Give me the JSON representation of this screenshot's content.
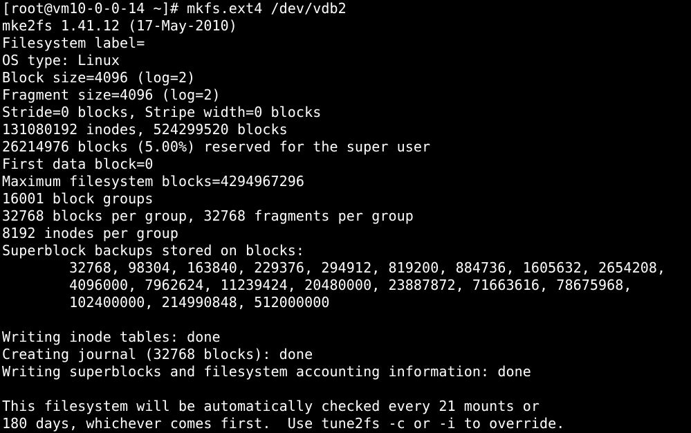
{
  "terminal": {
    "lines": [
      "[root@vm10-0-0-14 ~]# mkfs.ext4 /dev/vdb2",
      "mke2fs 1.41.12 (17-May-2010)",
      "Filesystem label=",
      "OS type: Linux",
      "Block size=4096 (log=2)",
      "Fragment size=4096 (log=2)",
      "Stride=0 blocks, Stripe width=0 blocks",
      "131080192 inodes, 524299520 blocks",
      "26214976 blocks (5.00%) reserved for the super user",
      "First data block=0",
      "Maximum filesystem blocks=4294967296",
      "16001 block groups",
      "32768 blocks per group, 32768 fragments per group",
      "8192 inodes per group",
      "Superblock backups stored on blocks:",
      "        32768, 98304, 163840, 229376, 294912, 819200, 884736, 1605632, 2654208,",
      "        4096000, 7962624, 11239424, 20480000, 23887872, 71663616, 78675968,",
      "        102400000, 214990848, 512000000",
      "",
      "Writing inode tables: done",
      "Creating journal (32768 blocks): done",
      "Writing superblocks and filesystem accounting information: done",
      "",
      "This filesystem will be automatically checked every 21 mounts or",
      "180 days, whichever comes first.  Use tune2fs -c or -i to override."
    ]
  }
}
